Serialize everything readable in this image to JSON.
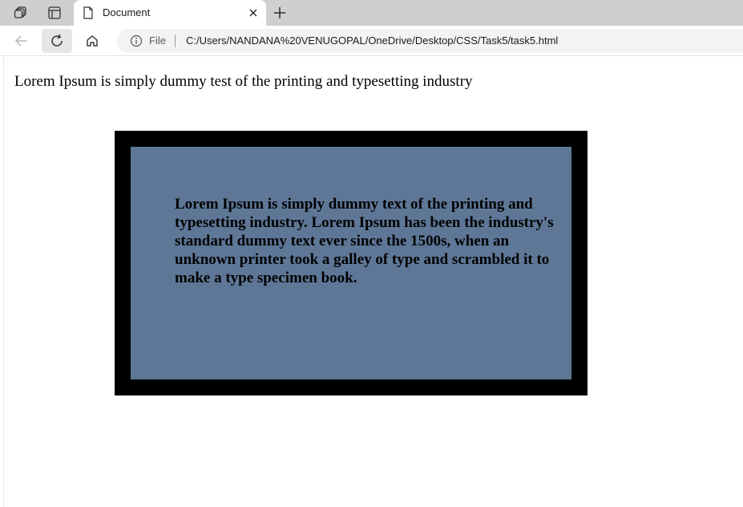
{
  "browser": {
    "tab": {
      "title": "Document"
    },
    "address": {
      "scheme_label": "File",
      "url": "C:/Users/NANDANA%20VENUGOPAL/OneDrive/Desktop/CSS/Task5/task5.html"
    }
  },
  "page": {
    "intro_text": "Lorem Ipsum is simply dummy test of the printing and typesetting industry",
    "box_text": "Lorem Ipsum is simply dummy text of the printing and typesetting industry. Lorem Ipsum has been the industry's standard dummy text ever since the 1500s, when an unknown printer took a galley of type and scrambled it to make a type specimen book.",
    "box_colors": {
      "border": "#000000",
      "fill": "#5e7797"
    }
  },
  "icons": [
    "workspaces-icon",
    "tab-actions-icon",
    "document-icon",
    "close-icon",
    "plus-icon",
    "back-arrow-icon",
    "refresh-icon",
    "home-icon",
    "info-icon"
  ]
}
